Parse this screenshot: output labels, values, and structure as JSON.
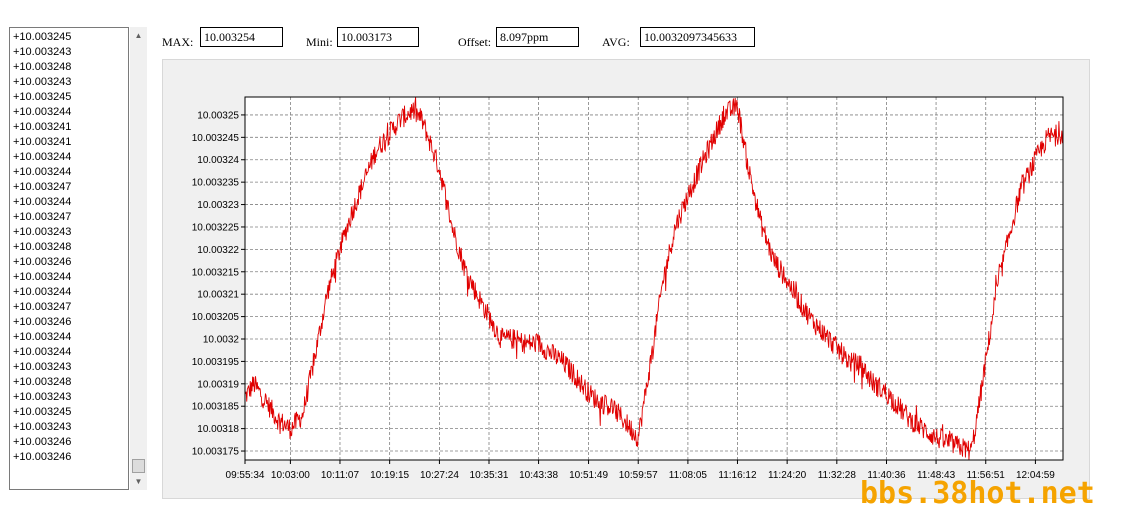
{
  "readings": [
    "+10.003245",
    "+10.003243",
    "+10.003248",
    "+10.003243",
    "+10.003245",
    "+10.003244",
    "+10.003241",
    "+10.003241",
    "+10.003244",
    "+10.003244",
    "+10.003247",
    "+10.003244",
    "+10.003247",
    "+10.003243",
    "+10.003248",
    "+10.003246",
    "+10.003244",
    "+10.003244",
    "+10.003247",
    "+10.003246",
    "+10.003244",
    "+10.003244",
    "+10.003243",
    "+10.003248",
    "+10.003243",
    "+10.003245",
    "+10.003243",
    "+10.003246",
    "+10.003246"
  ],
  "stats": {
    "max_label": "MAX:",
    "max_value": "10.003254",
    "min_label": "Mini:",
    "min_value": "10.003173",
    "offset_label": "Offset:",
    "offset_value": "8.097ppm",
    "avg_label": "AVG:",
    "avg_value": "10.0032097345633"
  },
  "watermark": "bbs.38hot.net",
  "chart_data": {
    "type": "line",
    "x_ticks": [
      "09:55:34",
      "10:03:00",
      "10:11:07",
      "10:19:15",
      "10:27:24",
      "10:35:31",
      "10:43:38",
      "10:51:49",
      "10:59:57",
      "11:08:05",
      "11:16:12",
      "11:24:20",
      "11:32:28",
      "11:40:36",
      "11:48:43",
      "11:56:51",
      "12:04:59"
    ],
    "y_ticks": [
      10.00325,
      10.003245,
      10.00324,
      10.003235,
      10.00323,
      10.003225,
      10.00322,
      10.003215,
      10.00321,
      10.003205,
      10.0032,
      10.003195,
      10.00319,
      10.003185,
      10.00318,
      10.003175
    ],
    "y_tick_labels": [
      "10.00325",
      "10.003245",
      "10.00324",
      "10.003235",
      "10.00323",
      "10.003225",
      "10.00322",
      "10.003215",
      "10.00321",
      "10.003205",
      "10.0032",
      "10.003195",
      "10.00319",
      "10.003185",
      "10.00318",
      "10.003175"
    ],
    "ylim": [
      10.003173,
      10.003254
    ],
    "xlim": [
      "09:55:34",
      "12:09:30"
    ],
    "grid": true,
    "series": [
      {
        "color": "#e00000",
        "x": [
          "09:55:34",
          "09:57:00",
          "09:59:00",
          "10:01:00",
          "10:03:00",
          "10:05:00",
          "10:07:00",
          "10:09:00",
          "10:11:07",
          "10:13:00",
          "10:15:00",
          "10:17:00",
          "10:19:15",
          "10:21:00",
          "10:23:00",
          "10:24:30",
          "10:27:24",
          "10:29:30",
          "10:31:30",
          "10:33:30",
          "10:35:31",
          "10:37:30",
          "10:39:30",
          "10:41:30",
          "10:43:38",
          "10:45:30",
          "10:47:30",
          "10:49:30",
          "10:51:49",
          "10:53:30",
          "10:55:30",
          "10:57:30",
          "10:59:57",
          "11:02:00",
          "11:04:00",
          "11:06:00",
          "11:08:05",
          "11:10:00",
          "11:12:00",
          "11:14:00",
          "11:16:12",
          "11:18:00",
          "11:20:00",
          "11:22:00",
          "11:24:20",
          "11:26:30",
          "11:28:30",
          "11:30:30",
          "11:32:28",
          "11:34:30",
          "11:36:30",
          "11:38:30",
          "11:40:36",
          "11:42:30",
          "11:44:30",
          "11:46:30",
          "11:48:43",
          "11:50:30",
          "11:52:30",
          "11:54:30",
          "11:55:30",
          "11:56:51",
          "11:58:30",
          "12:00:30",
          "12:02:30",
          "12:04:59",
          "12:07:00",
          "12:09:30"
        ],
        "y": [
          10.003187,
          10.00319,
          10.003186,
          10.003182,
          10.00318,
          10.003183,
          10.003196,
          10.00321,
          10.00322,
          10.003228,
          10.003235,
          10.003242,
          10.003246,
          10.003249,
          10.003251,
          10.003249,
          10.003238,
          10.003225,
          10.003216,
          10.00321,
          10.003205,
          10.0032,
          10.0032,
          10.003199,
          10.003199,
          10.003197,
          10.003195,
          10.003192,
          10.003188,
          10.003186,
          10.003185,
          10.003182,
          10.003178,
          10.003195,
          10.003213,
          10.003225,
          10.003232,
          10.003238,
          10.003244,
          10.00325,
          10.003252,
          10.003238,
          10.003226,
          10.003218,
          10.003213,
          10.003208,
          10.003204,
          10.003201,
          10.003198,
          10.003195,
          10.003194,
          10.00319,
          10.003188,
          10.003185,
          10.003182,
          10.00318,
          10.003178,
          10.003177,
          10.003176,
          10.003175,
          10.003183,
          10.003195,
          10.00321,
          10.003222,
          10.003233,
          10.00324,
          10.003245,
          10.003246
        ]
      }
    ]
  }
}
